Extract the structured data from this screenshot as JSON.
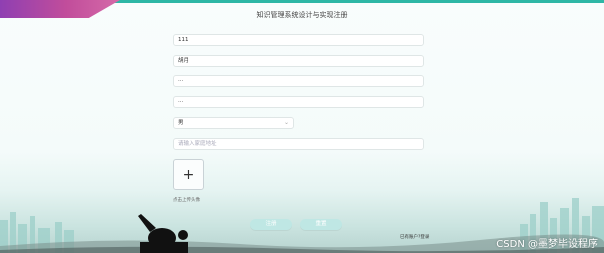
{
  "page": {
    "title": "知识管理系统设计与实现注册"
  },
  "form": {
    "account": {
      "value": "111"
    },
    "name": {
      "value": "胡月"
    },
    "password": {
      "value": "···"
    },
    "confirm_password": {
      "value": "···"
    },
    "gender": {
      "value": "男"
    },
    "address": {
      "placeholder": "请输入家庭地址"
    },
    "avatar_label": "点击上传头像"
  },
  "actions": {
    "register": "注册",
    "reset": "重置",
    "login_link": "已有账户?登录"
  },
  "watermark": "CSDN @墨梦毕设程序",
  "colors": {
    "accent": "#2fb7a6",
    "button": "#bfe7e4",
    "corner": "#a84aa6"
  }
}
